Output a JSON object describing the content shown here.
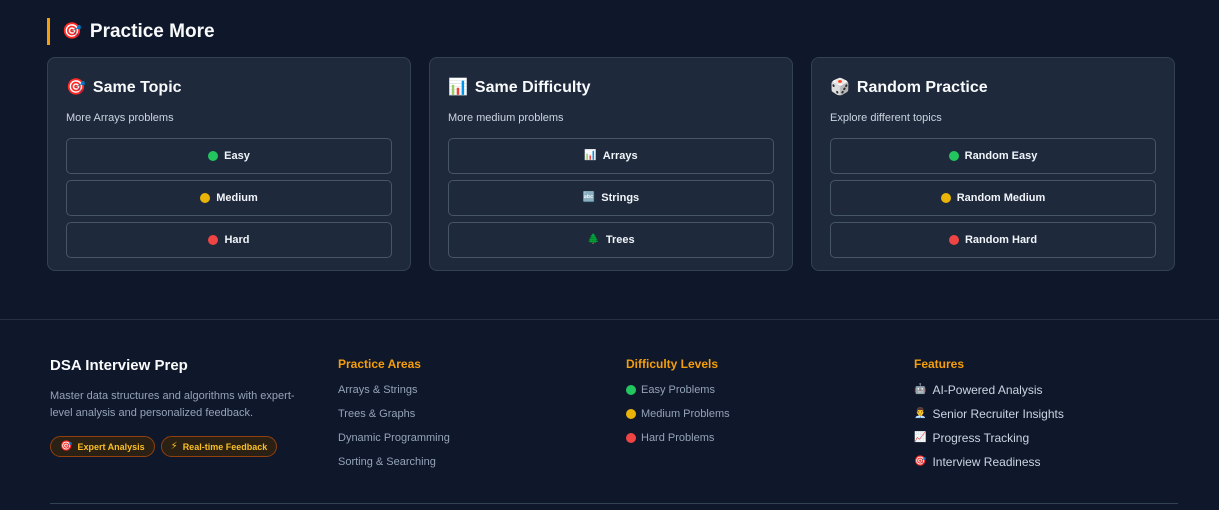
{
  "section": {
    "icon": "dart-icon",
    "title": "Practice More"
  },
  "cards": [
    {
      "icon": "dart-icon",
      "title": "Same Topic",
      "subtitle": "More Arrays problems",
      "buttons": [
        {
          "label": "Easy",
          "icon": "green-circle"
        },
        {
          "label": "Medium",
          "icon": "yellow-circle"
        },
        {
          "label": "Hard",
          "icon": "red-circle"
        }
      ]
    },
    {
      "icon": "bar-chart-icon",
      "title": "Same Difficulty",
      "subtitle": "More medium problems",
      "buttons": [
        {
          "label": "Arrays",
          "icon": "bar-chart-icon"
        },
        {
          "label": "Strings",
          "icon": "abc-icon"
        },
        {
          "label": "Trees",
          "icon": "tree-icon"
        }
      ]
    },
    {
      "icon": "dice-icon",
      "title": "Random Practice",
      "subtitle": "Explore different topics",
      "buttons": [
        {
          "label": "Random Easy",
          "icon": "green-circle"
        },
        {
          "label": "Random Medium",
          "icon": "yellow-circle"
        },
        {
          "label": "Random Hard",
          "icon": "red-circle"
        }
      ]
    }
  ],
  "footer": {
    "brand": {
      "title": "DSA Interview Prep",
      "description": "Master data structures and algorithms with expert-level analysis and personalized feedback.",
      "badges": [
        {
          "label": "Expert Analysis",
          "icon": "dart-icon"
        },
        {
          "label": "Real-time Feedback",
          "icon": "lightning-icon"
        }
      ]
    },
    "practice_areas": {
      "heading": "Practice Areas",
      "items": [
        "Arrays & Strings",
        "Trees & Graphs",
        "Dynamic Programming",
        "Sorting & Searching"
      ]
    },
    "difficulty_levels": {
      "heading": "Difficulty Levels",
      "items": [
        {
          "label": "Easy Problems",
          "icon": "green-circle"
        },
        {
          "label": "Medium Problems",
          "icon": "yellow-circle"
        },
        {
          "label": "Hard Problems",
          "icon": "red-circle"
        }
      ]
    },
    "features": {
      "heading": "Features",
      "items": [
        {
          "label": "AI-Powered Analysis",
          "icon": "robot-icon"
        },
        {
          "label": "Senior Recruiter Insights",
          "icon": "person-icon"
        },
        {
          "label": "Progress Tracking",
          "icon": "line-chart-icon"
        },
        {
          "label": "Interview Readiness",
          "icon": "dart-icon"
        }
      ]
    }
  },
  "colors": {
    "background": "#0f172a",
    "card": "#1e293b",
    "accent": "#f59e0b",
    "easy": "#22c55e",
    "medium": "#eab308",
    "hard": "#ef4444"
  }
}
